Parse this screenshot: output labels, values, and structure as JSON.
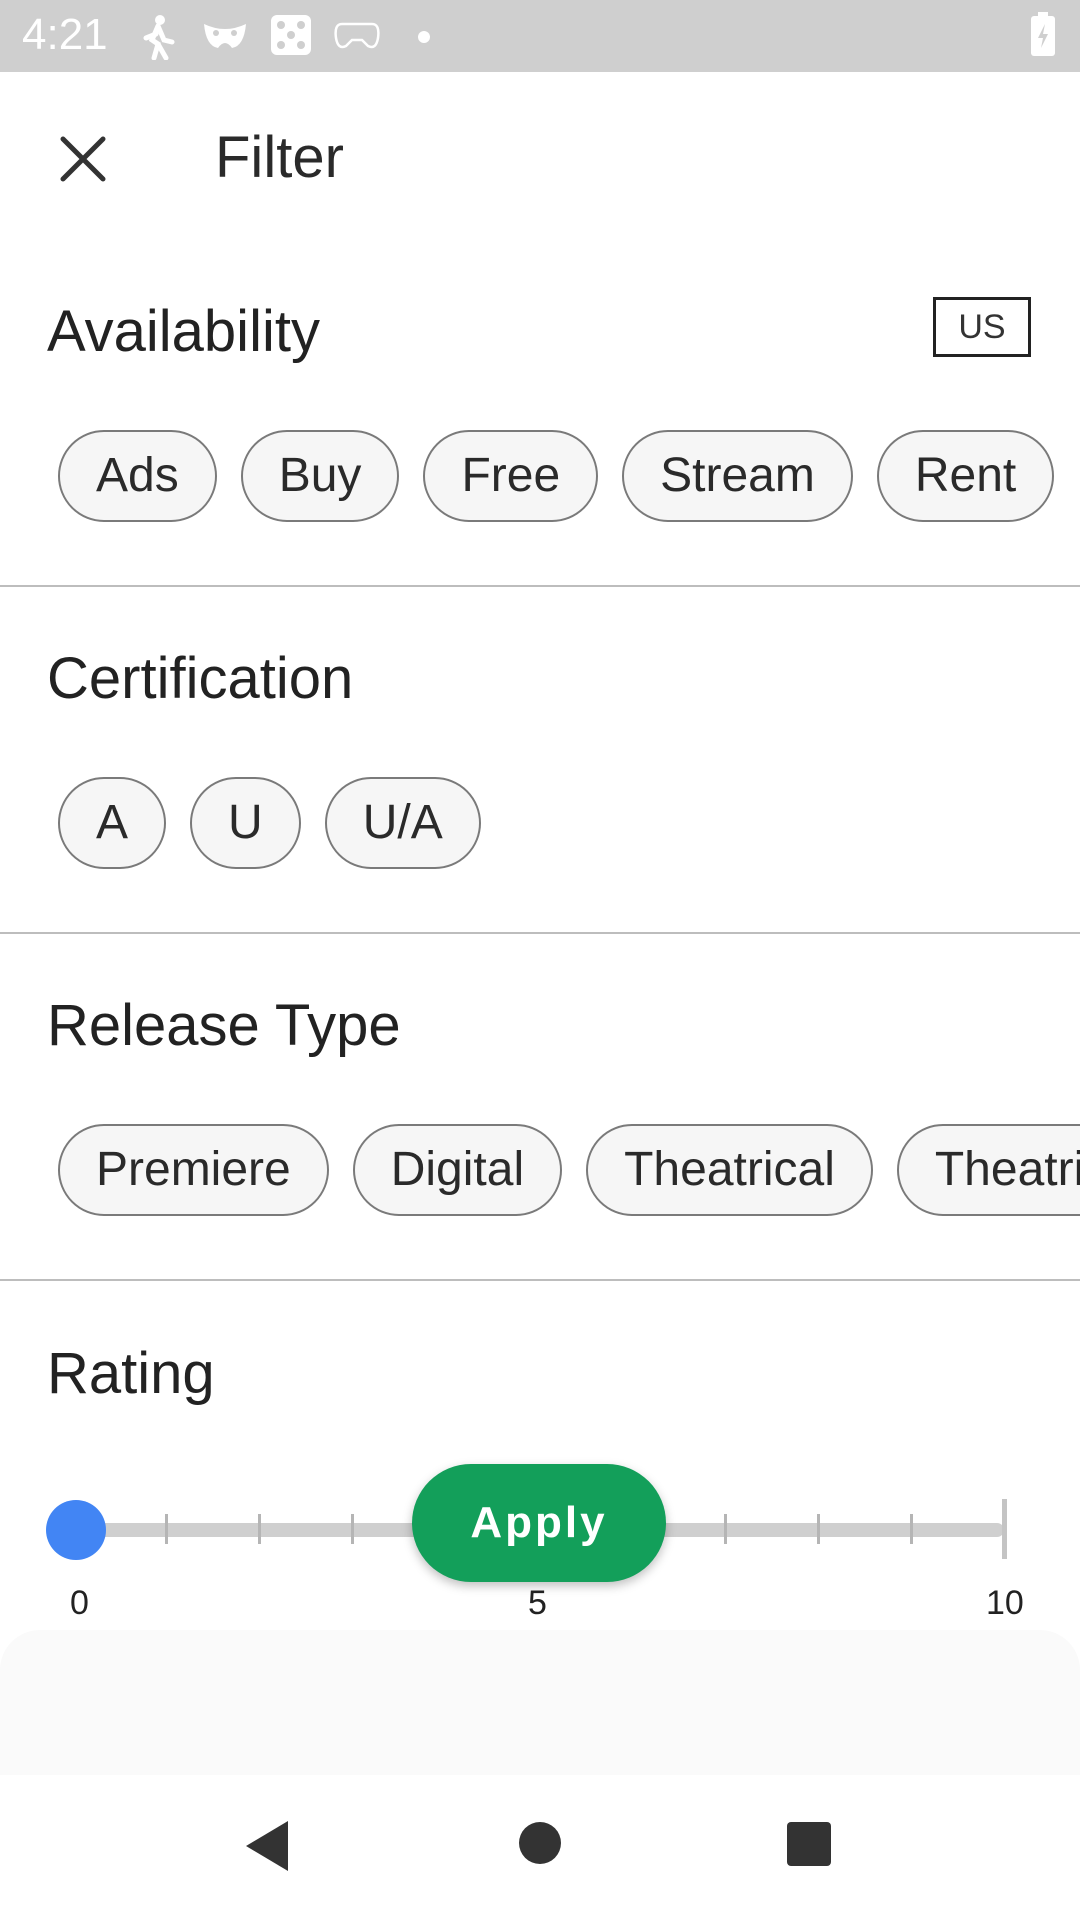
{
  "status_bar": {
    "time": "4:21",
    "icons": [
      "walk-icon",
      "mask-icon",
      "dice-icon",
      "gamepad-icon",
      "dot-icon",
      "battery-charging-icon"
    ]
  },
  "header": {
    "title": "Filter",
    "close_icon": "close-icon"
  },
  "availability": {
    "title": "Availability",
    "region": "US",
    "options": [
      "Ads",
      "Buy",
      "Free",
      "Stream",
      "Rent"
    ]
  },
  "certification": {
    "title": "Certification",
    "options": [
      "A",
      "U",
      "U/A"
    ]
  },
  "release_type": {
    "title": "Release Type",
    "options": [
      "Premiere",
      "Digital",
      "Theatrical",
      "Theatrical"
    ]
  },
  "rating": {
    "title": "Rating",
    "min_label": "0",
    "mid_label": "5",
    "max_label": "10",
    "value": 0,
    "thumb_color": "#4285f4"
  },
  "apply_button": {
    "label": "Apply",
    "color": "#139f5a"
  },
  "nav_bar": {
    "icons": [
      "back-icon",
      "home-icon",
      "recents-icon"
    ]
  }
}
